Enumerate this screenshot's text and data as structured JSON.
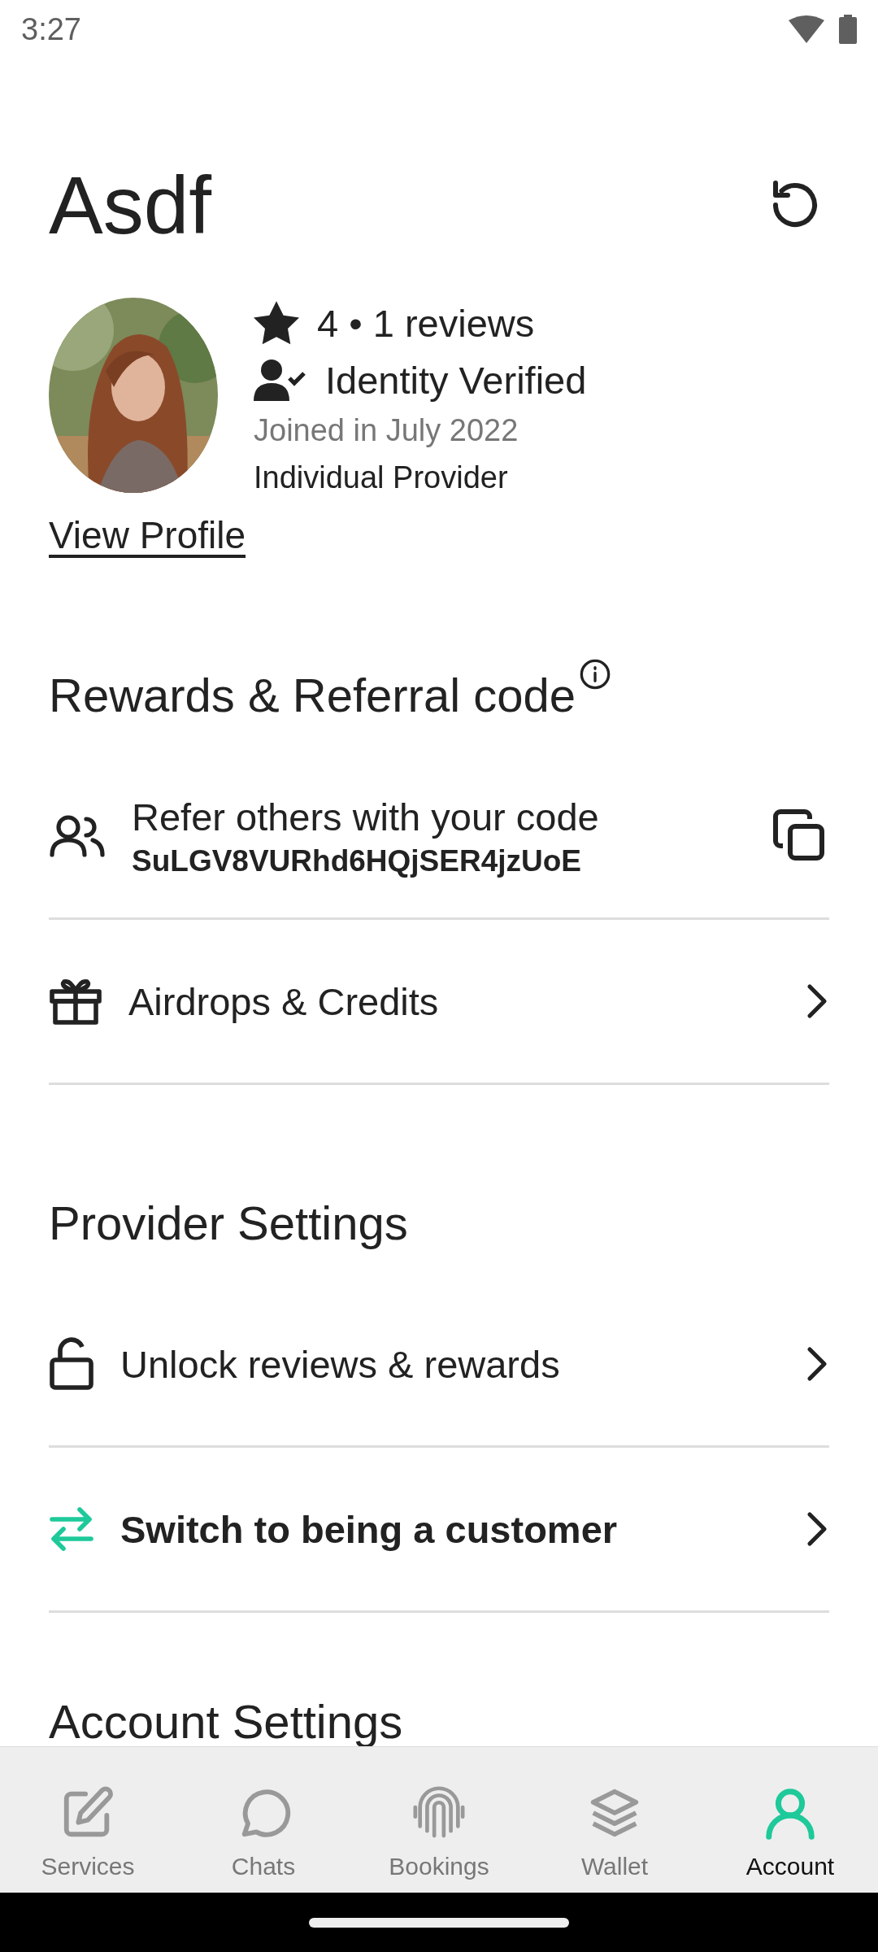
{
  "status_bar": {
    "time": "3:27"
  },
  "profile": {
    "name": "Asdf",
    "rating": "4 • 1 reviews",
    "verification": "Identity Verified",
    "joined": "Joined in July 2022",
    "role": "Individual Provider",
    "link": "View Profile"
  },
  "sections": [
    {
      "title": "Rewards & Referral code",
      "info": true,
      "rows": [
        {
          "kind": "referral",
          "label": "Refer others with your code",
          "code": "SuLGV8VURhd6HQjSER4jzUoE"
        },
        {
          "kind": "airdrops",
          "label": "Airdrops & Credits"
        }
      ]
    },
    {
      "title": "Provider Settings",
      "info": false,
      "rows": [
        {
          "kind": "unlock",
          "label": "Unlock reviews & rewards"
        },
        {
          "kind": "switch",
          "label": "Switch to being a customer"
        }
      ]
    },
    {
      "title": "Account Settings",
      "info": false
    }
  ],
  "nav": [
    {
      "label": "Services",
      "selected": false
    },
    {
      "label": "Chats",
      "selected": false
    },
    {
      "label": "Bookings",
      "selected": false
    },
    {
      "label": "Wallet",
      "selected": false
    },
    {
      "label": "Account",
      "selected": true
    }
  ]
}
